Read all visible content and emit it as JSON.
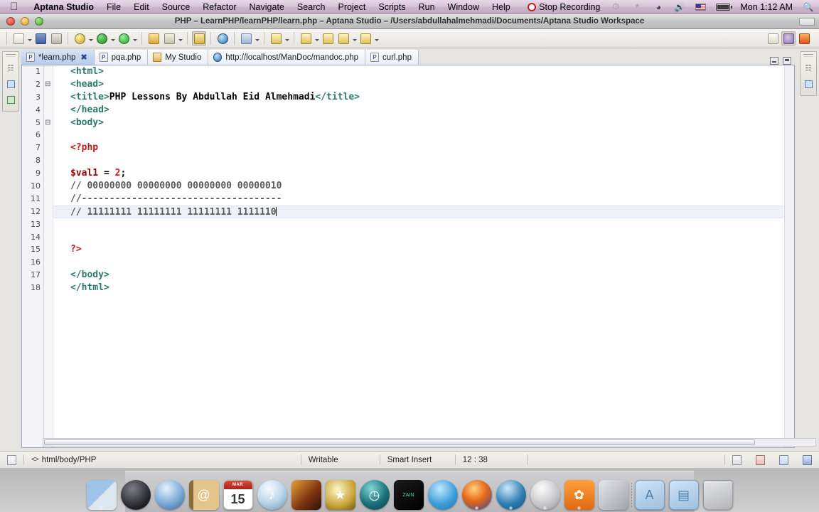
{
  "menubar": {
    "apple_icon": "apple-logo",
    "items": [
      {
        "label": "Aptana Studio",
        "bold": true
      },
      {
        "label": "File"
      },
      {
        "label": "Edit"
      },
      {
        "label": "Source"
      },
      {
        "label": "Refactor"
      },
      {
        "label": "Navigate"
      },
      {
        "label": "Search"
      },
      {
        "label": "Project"
      },
      {
        "label": "Scripts"
      },
      {
        "label": "Run"
      },
      {
        "label": "Window"
      },
      {
        "label": "Help"
      }
    ],
    "recording": "Stop Recording",
    "status_icons": [
      "time-machine-icon",
      "bluetooth-icon",
      "wifi-icon",
      "volume-icon",
      "us-flag-icon",
      "battery-icon"
    ],
    "clock": "Mon 1:12 AM",
    "search_icon": "spotlight-search-icon"
  },
  "window": {
    "title": "PHP – LearnPHP/learnPHP/learn.php – Aptana Studio – /Users/abdullahalmehmadi/Documents/Aptana Studio Workspace",
    "controls": [
      "close-button",
      "minimize-button",
      "zoom-button"
    ]
  },
  "toolbar": {
    "buttons": [
      {
        "name": "new-file-button",
        "icon": "new-file-icon",
        "dropdown": true
      },
      {
        "name": "save-button",
        "icon": "save-icon",
        "dropdown": false
      },
      {
        "name": "print-button",
        "icon": "print-icon",
        "dropdown": false
      },
      {
        "name": "debug-button",
        "icon": "debug-bug-icon",
        "dropdown": true
      },
      {
        "name": "run-button",
        "icon": "run-play-icon",
        "dropdown": true
      },
      {
        "name": "run-as-button",
        "icon": "run-external-icon",
        "dropdown": true
      },
      {
        "name": "open-folder-button",
        "icon": "open-folder-icon",
        "dropdown": false
      },
      {
        "name": "validate-button",
        "icon": "wand-icon",
        "dropdown": true
      },
      {
        "name": "preview-button",
        "icon": "pencil-preview-icon",
        "dropdown": false,
        "pressed": true
      },
      {
        "name": "browser-button",
        "icon": "globe-icon",
        "dropdown": false
      },
      {
        "name": "home-button",
        "icon": "home-icon",
        "dropdown": true
      },
      {
        "name": "next-annotation-button",
        "icon": "arrow-down-marker-icon",
        "dropdown": true
      },
      {
        "name": "prev-annotation-button",
        "icon": "arrow-up-marker-icon",
        "dropdown": true
      },
      {
        "name": "back-button",
        "icon": "arrow-back-icon",
        "dropdown": false
      },
      {
        "name": "forward-button",
        "icon": "arrow-forward-icon",
        "dropdown": true
      },
      {
        "name": "last-edit-button",
        "icon": "arrow-right-icon",
        "dropdown": true
      }
    ],
    "perspective_buttons": [
      {
        "name": "open-perspective-button",
        "icon": "open-perspective-icon"
      },
      {
        "name": "perspective-web-button",
        "icon": "perspective-web-icon",
        "active": true
      },
      {
        "name": "perspective-php-button",
        "icon": "perspective-php-icon"
      }
    ]
  },
  "editor": {
    "tabs": [
      {
        "label": "*learn.php",
        "icon": "php-file-icon",
        "active": true,
        "closeable": true
      },
      {
        "label": "pqa.php",
        "icon": "php-file-icon",
        "active": false,
        "closeable": false
      },
      {
        "label": "My Studio",
        "icon": "studio-icon",
        "active": false,
        "closeable": false
      },
      {
        "label": "http://localhost/ManDoc/mandoc.php",
        "icon": "web-icon",
        "active": false,
        "closeable": false
      },
      {
        "label": "curl.php",
        "icon": "php-file-icon",
        "active": false,
        "closeable": false
      }
    ],
    "panel_controls": [
      {
        "name": "minimize-editor-button",
        "icon": "minimize-icon"
      },
      {
        "name": "maximize-editor-button",
        "icon": "maximize-icon"
      }
    ],
    "current_line": 12,
    "lines": [
      {
        "n": 1,
        "fold": false,
        "segments": [
          {
            "t": "<html>",
            "c": "tag"
          }
        ]
      },
      {
        "n": 2,
        "fold": true,
        "segments": [
          {
            "t": "<head>",
            "c": "tag"
          }
        ]
      },
      {
        "n": 3,
        "fold": false,
        "segments": [
          {
            "t": "<title>",
            "c": "tag"
          },
          {
            "t": "PHP Lessons By Abdullah Eid Almehmadi",
            "c": "txt"
          },
          {
            "t": "</title>",
            "c": "tag"
          }
        ]
      },
      {
        "n": 4,
        "fold": false,
        "segments": [
          {
            "t": "</head>",
            "c": "tag"
          }
        ]
      },
      {
        "n": 5,
        "fold": true,
        "segments": [
          {
            "t": "<body>",
            "c": "tag"
          }
        ]
      },
      {
        "n": 6,
        "fold": false,
        "segments": []
      },
      {
        "n": 7,
        "fold": false,
        "segments": [
          {
            "t": "<?php",
            "c": "php"
          }
        ]
      },
      {
        "n": 8,
        "fold": false,
        "segments": []
      },
      {
        "n": 9,
        "fold": false,
        "segments": [
          {
            "t": "$val1",
            "c": "var"
          },
          {
            "t": " = ",
            "c": "op"
          },
          {
            "t": "2",
            "c": "num"
          },
          {
            "t": ";",
            "c": "op"
          }
        ]
      },
      {
        "n": 10,
        "fold": false,
        "segments": [
          {
            "t": "// 00000000 00000000 00000000 00000010",
            "c": "cmt"
          }
        ]
      },
      {
        "n": 11,
        "fold": false,
        "segments": [
          {
            "t": "//------------------------------------",
            "c": "cmt"
          }
        ]
      },
      {
        "n": 12,
        "fold": false,
        "segments": [
          {
            "t": "// 11111111 11111111 11111111 1111110",
            "c": "cmt"
          }
        ]
      },
      {
        "n": 13,
        "fold": false,
        "segments": []
      },
      {
        "n": 14,
        "fold": false,
        "segments": []
      },
      {
        "n": 15,
        "fold": false,
        "segments": [
          {
            "t": "?>",
            "c": "php"
          }
        ]
      },
      {
        "n": 16,
        "fold": false,
        "segments": []
      },
      {
        "n": 17,
        "fold": false,
        "segments": [
          {
            "t": "</body>",
            "c": "tag"
          }
        ]
      },
      {
        "n": 18,
        "fold": false,
        "segments": [
          {
            "t": "</html>",
            "c": "tag"
          }
        ]
      }
    ]
  },
  "left_view_stack": {
    "icons": [
      "restore-view-icon",
      "project-explorer-icon",
      "outline-icon"
    ]
  },
  "right_view_stack": {
    "icons": [
      "restore-view-icon",
      "outline-view-icon"
    ]
  },
  "statusbar": {
    "left_icon": "writable-doc-icon",
    "breadcrumb_arrows": "<>",
    "breadcrumb": "html/body/PHP",
    "writable": "Writable",
    "insert_mode": "Smart Insert",
    "position": "12 : 38",
    "right_icons": [
      "tile-windows-icon",
      "problems-icon",
      "tasks-icon",
      "console-icon"
    ]
  },
  "dock": {
    "items": [
      {
        "name": "finder",
        "class": "dk-finder",
        "glyph": "",
        "round": false,
        "running": true
      },
      {
        "name": "dashboard",
        "class": "dk-dash",
        "glyph": "",
        "round": true,
        "running": false
      },
      {
        "name": "safari",
        "class": "dk-safari",
        "glyph": "",
        "round": true,
        "running": false
      },
      {
        "name": "address-book",
        "class": "dk-contacts",
        "glyph": "@",
        "round": false,
        "running": false
      },
      {
        "name": "calendar",
        "class": "dk-cal",
        "glyph": "15",
        "round": false,
        "running": false,
        "cal_month": "MAR"
      },
      {
        "name": "itunes",
        "class": "dk-itunes",
        "glyph": "♪",
        "round": true,
        "running": false
      },
      {
        "name": "iphoto",
        "class": "dk-iphoto",
        "glyph": "",
        "round": false,
        "running": false
      },
      {
        "name": "imovie",
        "class": "dk-imovie",
        "glyph": "★",
        "round": false,
        "running": false
      },
      {
        "name": "time-machine",
        "class": "dk-tm",
        "glyph": "◷",
        "round": true,
        "running": false
      },
      {
        "name": "zain",
        "class": "dk-zain",
        "glyph": "",
        "round": false,
        "running": false,
        "caption": "ZAIN"
      },
      {
        "name": "messenger",
        "class": "dk-msn",
        "glyph": "",
        "round": true,
        "running": false
      },
      {
        "name": "firefox",
        "class": "dk-firefox",
        "glyph": "",
        "round": true,
        "running": true
      },
      {
        "name": "quicktime",
        "class": "dk-qt",
        "glyph": "",
        "round": true,
        "running": true
      },
      {
        "name": "aptana-studio",
        "class": "dk-aptana",
        "glyph": "",
        "round": true,
        "running": true
      },
      {
        "name": "system-preferences",
        "class": "dk-gear",
        "glyph": "✿",
        "round": false,
        "running": true
      },
      {
        "name": "photo-booth",
        "class": "dk-booth",
        "glyph": "",
        "round": false,
        "running": false
      },
      {
        "name": "separator",
        "class": "",
        "glyph": "",
        "round": false,
        "running": false,
        "separator": true
      },
      {
        "name": "applications-folder",
        "class": "dk-apps",
        "glyph": "A",
        "round": false,
        "running": false
      },
      {
        "name": "documents-folder",
        "class": "dk-docs",
        "glyph": "▤",
        "round": false,
        "running": false
      },
      {
        "name": "trash",
        "class": "dk-trash",
        "glyph": "",
        "round": false,
        "running": false
      }
    ]
  },
  "colors": {
    "tag": "#2e7a6e",
    "php_delimiter": "#c01818",
    "variable": "#990000",
    "number": "#cc2222",
    "comment": "#5b5b5b",
    "current_line_highlight": "#eef1fa",
    "active_tab": "#b7cbeb",
    "recording_red": "#c41a1a"
  }
}
